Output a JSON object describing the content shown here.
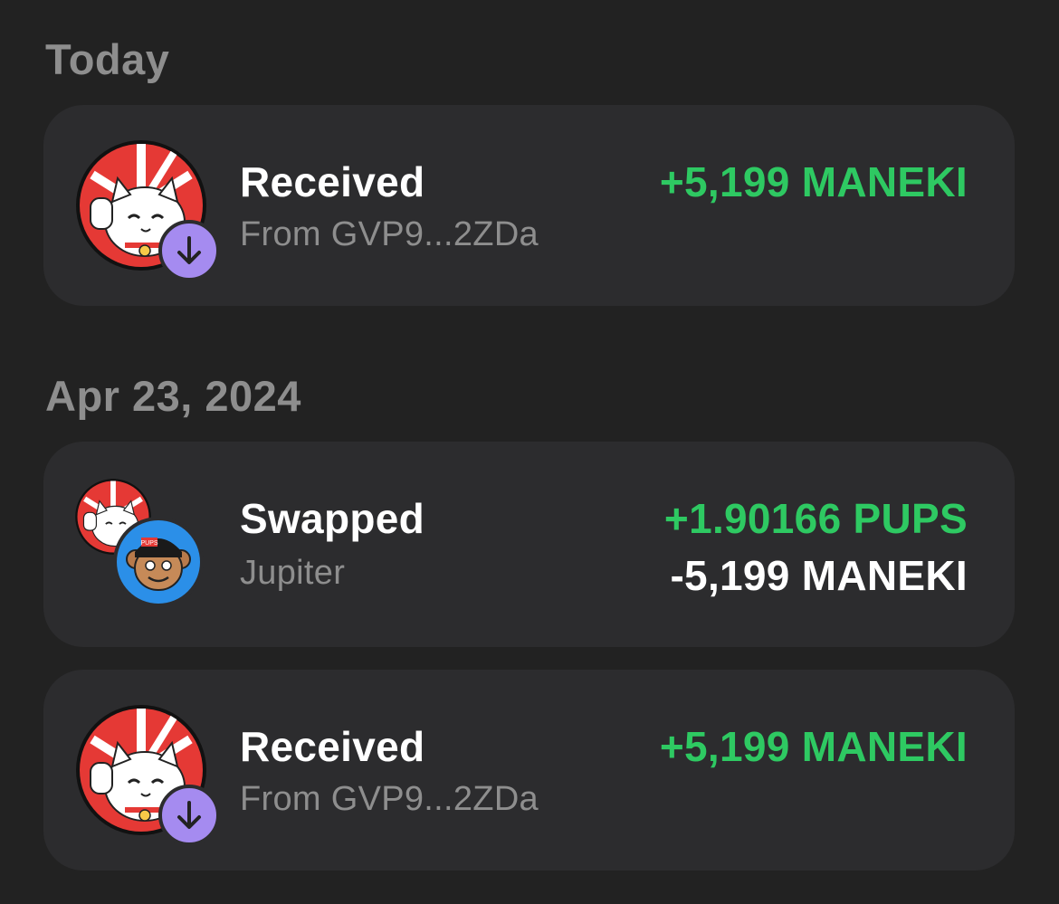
{
  "sections": [
    {
      "header": "Today",
      "transactions": [
        {
          "title": "Received",
          "subtitle": "From GVP9...2ZDa",
          "amount_primary": "+5,199 MANEKI",
          "icon": "maneki-token-icon",
          "badge_icon": "arrow-down-icon"
        }
      ]
    },
    {
      "header": "Apr 23, 2024",
      "transactions": [
        {
          "title": "Swapped",
          "subtitle": "Jupiter",
          "amount_primary": "+1.90166 PUPS",
          "amount_secondary": "-5,199 MANEKI",
          "icon": "maneki-token-icon",
          "icon_secondary": "pups-token-icon"
        },
        {
          "title": "Received",
          "subtitle": "From GVP9...2ZDa",
          "amount_primary": "+5,199 MANEKI",
          "icon": "maneki-token-icon",
          "badge_icon": "arrow-down-icon"
        }
      ]
    }
  ],
  "colors": {
    "background": "#222222",
    "card": "#2c2c2e",
    "positive": "#2ec962",
    "negative": "#ffffff",
    "muted": "#8e8e8e",
    "badge": "#a58bf0",
    "pups_bg": "#2b8fe8"
  },
  "pups_cap_text": "PUPS"
}
